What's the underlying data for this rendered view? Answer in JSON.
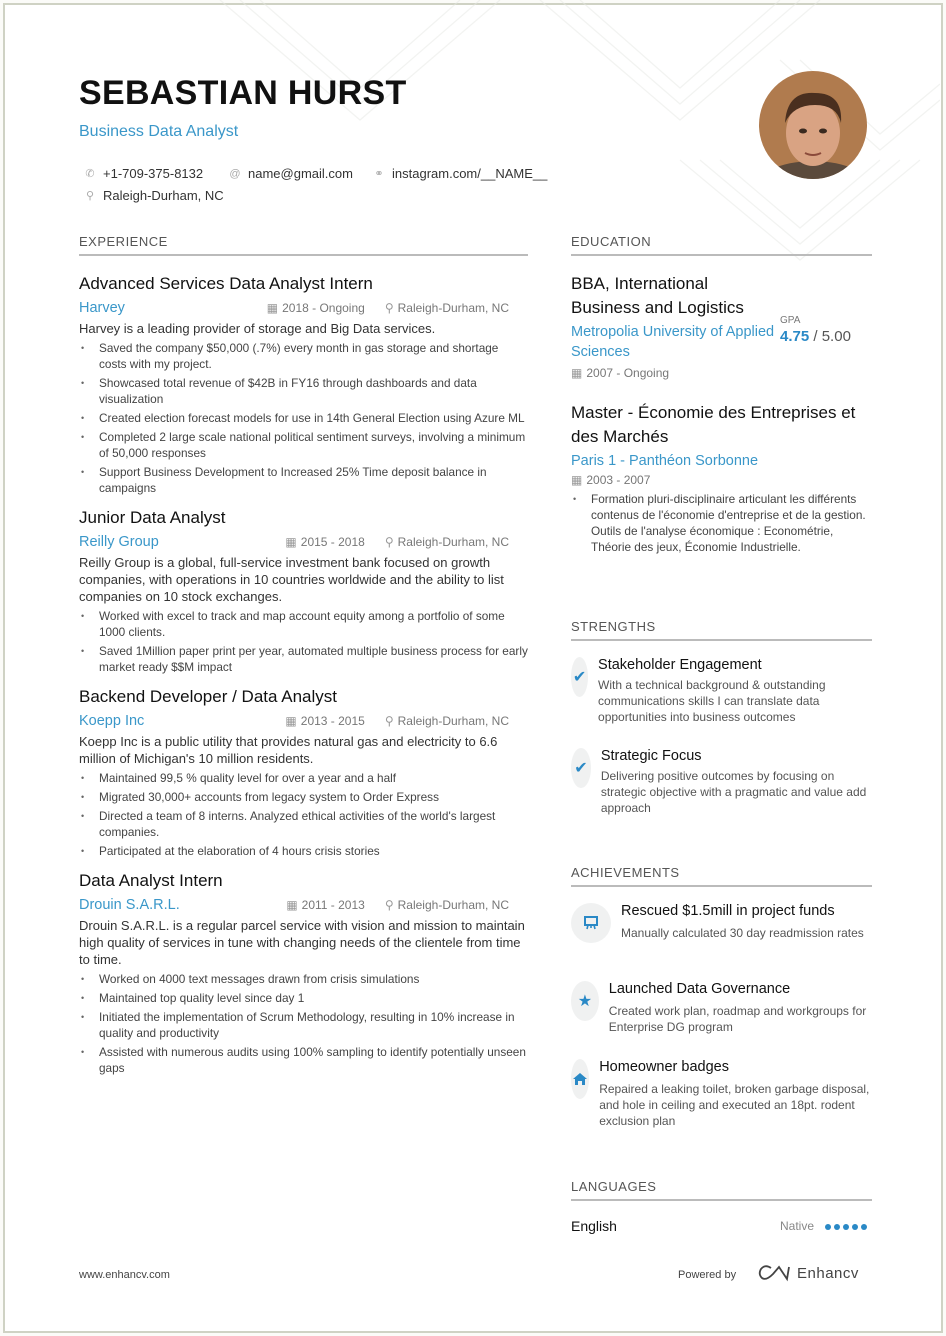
{
  "header": {
    "name": "SEBASTIAN HURST",
    "title": "Business Data Analyst",
    "phone": "+1-709-375-8132",
    "email": "name@gmail.com",
    "link": "instagram.com/__NAME__",
    "location": "Raleigh-Durham, NC"
  },
  "icons": {
    "phone": "phone-icon",
    "email": "at-icon",
    "link": "link-icon",
    "location": "location-pin-icon",
    "calendar": "calendar-icon"
  },
  "colors": {
    "accent": "#3a97c9",
    "icon_blue": "#2a89c6"
  },
  "experience": {
    "heading": "EXPERIENCE",
    "jobs": [
      {
        "title": "Advanced Services Data Analyst Intern",
        "company": "Harvey",
        "dates": "2018 - Ongoing",
        "location": "Raleigh-Durham, NC",
        "description": "Harvey is a leading provider of storage and Big Data services.",
        "bullets": [
          "Saved the company $50,000 (.7%) every month in gas storage and shortage costs with my project.",
          "Showcased total revenue of $42B in FY16 through dashboards and data visualization",
          "Created election forecast models for use in 14th General Election using Azure ML",
          "Completed 2 large scale national political sentiment surveys, involving a minimum of 50,000 responses",
          "Support Business Development to Increased 25% Time deposit balance in campaigns"
        ]
      },
      {
        "title": "Junior Data Analyst",
        "company": "Reilly Group",
        "dates": "2015 - 2018",
        "location": "Raleigh-Durham, NC",
        "description": "Reilly Group is a global, full-service investment bank focused on growth companies, with operations in 10 countries worldwide and the ability to list companies on 10 stock exchanges.",
        "bullets": [
          "Worked with excel to track and map account equity among a portfolio of some 1000 clients.",
          "Saved 1Million paper print per year, automated multiple business process for early market ready $$M impact"
        ]
      },
      {
        "title": "Backend Developer / Data Analyst",
        "company": "Koepp Inc",
        "dates": "2013 - 2015",
        "location": "Raleigh-Durham, NC",
        "description": "Koepp Inc is a public utility that provides natural gas and electricity to 6.6 million of Michigan's 10 million residents.",
        "bullets": [
          "Maintained 99,5 % quality level for over a year and a half",
          "Migrated 30,000+ accounts from legacy system to Order Express",
          "Directed a team of 8 interns. Analyzed ethical activities of the world's largest companies.",
          "Participated at the elaboration of 4 hours crisis stories"
        ]
      },
      {
        "title": "Data Analyst Intern",
        "company": "Drouin S.A.R.L.",
        "dates": "2011 - 2013",
        "location": "Raleigh-Durham, NC",
        "description": "Drouin S.A.R.L. is a regular parcel service with vision and mission to maintain high quality of services in tune with changing needs of the clientele from time to time.",
        "bullets": [
          "Worked on 4000 text messages drawn from crisis simulations",
          "Maintained top quality level since day 1",
          "Initiated the implementation of Scrum Methodology, resulting in 10% increase in quality and productivity",
          "Assisted with numerous audits using 100% sampling to identify potentially unseen gaps"
        ]
      }
    ]
  },
  "education": {
    "heading": "EDUCATION",
    "items": [
      {
        "degree": "BBA, International Business and Logistics",
        "school": "Metropolia University of Applied Sciences",
        "dates": "2007 - Ongoing",
        "gpa_label": "GPA",
        "gpa": "4.75",
        "gpa_max": "5.00"
      },
      {
        "degree": "Master - Économie des Entreprises et des Marchés",
        "school": "Paris 1 - Panthéon Sorbonne",
        "dates": "2003 - 2007",
        "bullet_line1": "Formation pluri-disciplinaire articulant les différents contenus de l'économie d'entreprise et de la gestion.",
        "bullet_line2": "Outils de l'analyse économique : Econométrie, Théorie des jeux, Économie Industrielle."
      }
    ]
  },
  "strengths": {
    "heading": "STRENGTHS",
    "items": [
      {
        "icon": "check-icon",
        "title": "Stakeholder Engagement",
        "desc": "With a technical background & outstanding communications skills I can translate data opportunities into business outcomes"
      },
      {
        "icon": "check-icon",
        "title": "Strategic Focus",
        "desc": "Delivering positive outcomes by focusing on strategic objective with a pragmatic and value add approach"
      }
    ]
  },
  "achievements": {
    "heading": "ACHIEVEMENTS",
    "items": [
      {
        "icon": "presentation-board-icon",
        "title": "Rescued $1.5mill in project funds",
        "desc": "Manually calculated 30 day readmission rates"
      },
      {
        "icon": "star-icon",
        "title": "Launched Data Governance",
        "desc": "Created work plan, roadmap and workgroups for Enterprise DG program"
      },
      {
        "icon": "home-icon",
        "title": "Homeowner badges",
        "desc": "Repaired a leaking toilet, broken garbage disposal, and hole in ceiling and executed an 18pt. rodent exclusion plan"
      }
    ]
  },
  "languages": {
    "heading": "LANGUAGES",
    "items": [
      {
        "name": "English",
        "level": "Native",
        "rating": 5,
        "rating_max": 5
      }
    ]
  },
  "footer": {
    "website": "www.enhancv.com",
    "powered_by": "Powered by",
    "brand": "Enhancv"
  }
}
